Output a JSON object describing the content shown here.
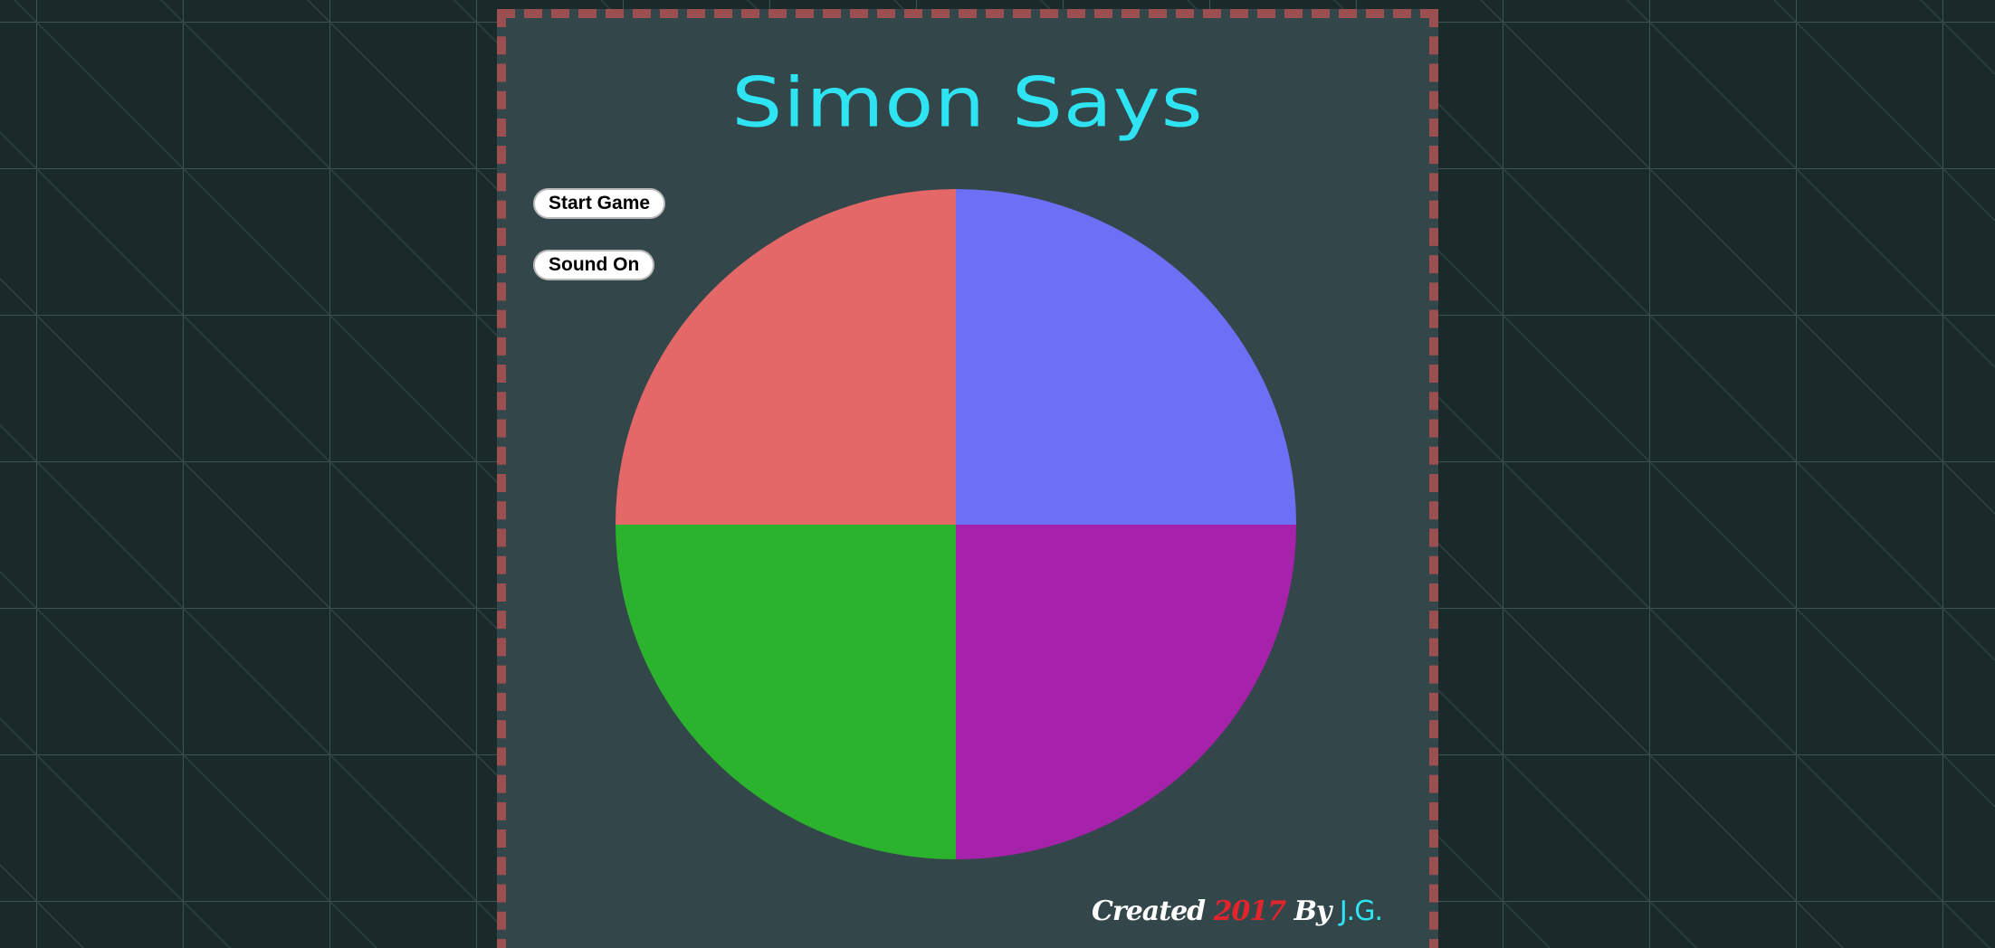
{
  "app": {
    "title": "Simon Says"
  },
  "controls": {
    "start_label": "Start Game",
    "sound_label": "Sound On"
  },
  "board": {
    "pads": [
      {
        "name": "red",
        "color": "#e56868"
      },
      {
        "name": "blue",
        "color": "#6d6ff5"
      },
      {
        "name": "green",
        "color": "#2bb32d"
      },
      {
        "name": "purple",
        "color": "#a622ab"
      }
    ]
  },
  "footer": {
    "created": "Created",
    "year": "2017",
    "by": "By",
    "author": "J.G."
  },
  "colors": {
    "background": "#1a2a2b",
    "panel": "#33474a",
    "panel_border": "#9c4f50",
    "title": "#2ee4f2",
    "year": "#e3242b"
  }
}
